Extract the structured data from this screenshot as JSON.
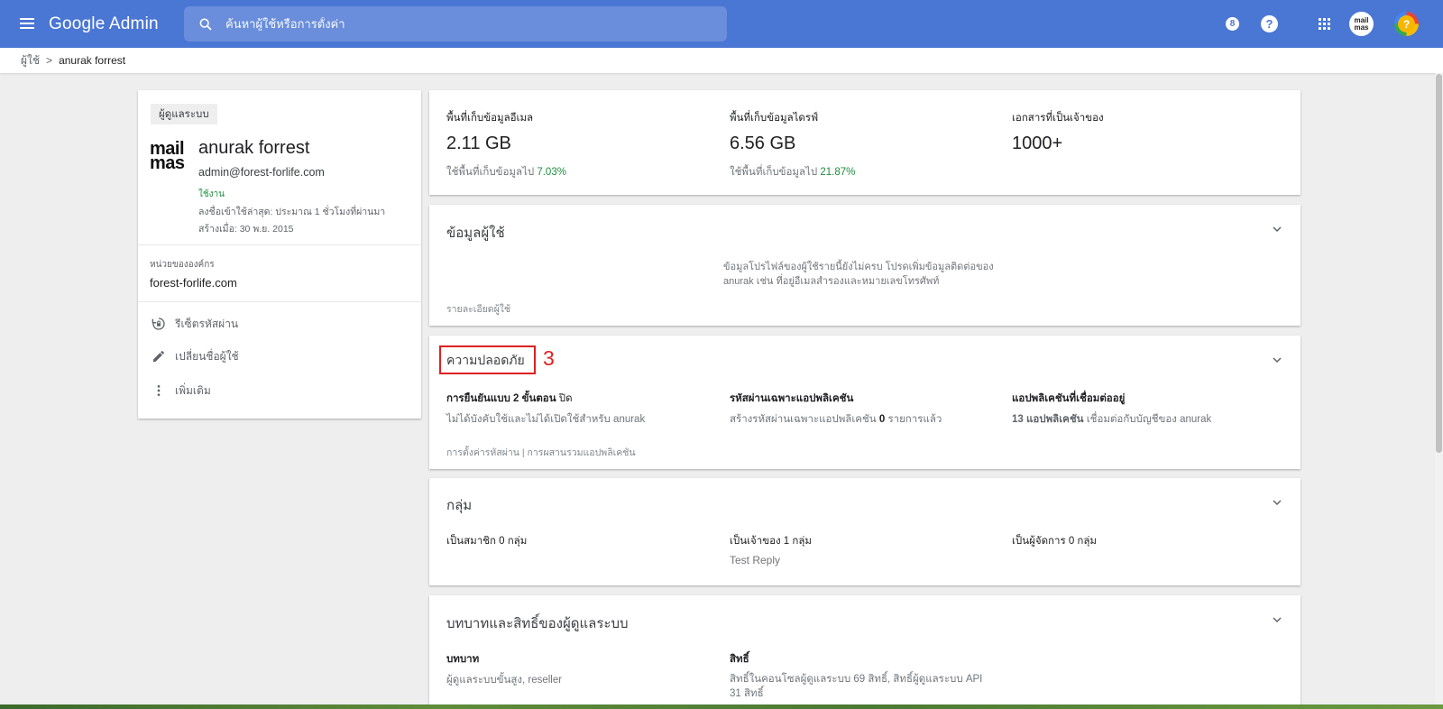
{
  "topbar": {
    "brand": "Google Admin",
    "search_placeholder": "ค้นหาผู้ใช้หรือการตั้งค่า",
    "notification_count": "8",
    "help_label": "?",
    "org_avatar_text": "mail\nmas",
    "user_avatar_text": "?"
  },
  "breadcrumb": {
    "root": "ผู้ใช้",
    "separator": ">",
    "current": "anurak forrest"
  },
  "profile": {
    "role": "ผู้ดูแลระบบ",
    "logo_text": "mail mas",
    "name": "anurak forrest",
    "email": "admin@forest-forlife.com",
    "status": "ใช้งาน",
    "last_login": "ลงชื่อเข้าใช้ล่าสุด: ประมาณ 1 ชั่วโมงที่ผ่านมา",
    "created": "สร้างเมื่อ: 30 พ.ย. 2015",
    "org_unit_label": "หน่วยขององค์กร",
    "org_unit_value": "forest-forlife.com",
    "actions": [
      {
        "label": "รีเซ็ตรหัสผ่าน",
        "icon": "lock-reset-icon"
      },
      {
        "label": "เปลี่ยนชื่อผู้ใช้",
        "icon": "pencil-icon"
      },
      {
        "label": "เพิ่มเติม",
        "icon": "more-vert-icon"
      }
    ]
  },
  "storage": {
    "email": {
      "label": "พื้นที่เก็บข้อมูลอีเมล",
      "value": "2.11 GB",
      "used_prefix": "ใช้พื้นที่เก็บข้อมูลไป",
      "used_pct": "7.03%"
    },
    "drive": {
      "label": "พื้นที่เก็บข้อมูลไดรฟ์",
      "value": "6.56 GB",
      "used_prefix": "ใช้พื้นที่เก็บข้อมูลไป",
      "used_pct": "21.87%"
    },
    "docs": {
      "label": "เอกสารที่เป็นเจ้าของ",
      "value": "1000+"
    }
  },
  "user_info": {
    "title": "ข้อมูลผู้ใช้",
    "message_line1": "ข้อมูลโปรไฟล์ของผู้ใช้รายนี้ยังไม่ครบ โปรดเพิ่มข้อมูลติดต่อของ",
    "message_line2": "anurak เช่น ที่อยู่อีเมลสำรองและหมายเลขโทรศัพท์",
    "footer_link": "รายละเอียดผู้ใช้"
  },
  "security": {
    "title": "ความปลอดภัย",
    "annotation": "3",
    "two_step": {
      "label_prefix": "การยืนยันแบบ 2 ขั้นตอน",
      "label_state": "ปิด",
      "detail": "ไม่ได้บังคับใช้และไม่ได้เปิดใช้สำหรับ anurak"
    },
    "app_passwords": {
      "label": "รหัสผ่านเฉพาะแอปพลิเคชัน",
      "detail_prefix": "สร้างรหัสผ่านเฉพาะแอปพลิเคชัน",
      "detail_count": "0",
      "detail_suffix": "รายการแล้ว"
    },
    "connected_apps": {
      "label": "แอปพลิเคชันที่เชื่อมต่ออยู่",
      "detail_bold": "13 แอปพลิเคชัน",
      "detail_suffix": "เชื่อมต่อกับบัญชีของ anurak"
    },
    "footer_link1": "การตั้งค่ารหัสผ่าน",
    "footer_sep": "|",
    "footer_link2": "การผสานรวมแอปพลิเคชัน"
  },
  "groups": {
    "title": "กลุ่ม",
    "member": "เป็นสมาชิก 0 กลุ่ม",
    "owner": "เป็นเจ้าของ 1 กลุ่ม",
    "owner_group": "Test Reply",
    "manager": "เป็นผู้จัดการ 0 กลุ่ม"
  },
  "roles": {
    "title": "บทบาทและสิทธิ์ของผู้ดูแลระบบ",
    "roles_label": "บทบาท",
    "roles_value": "ผู้ดูแลระบบขั้นสูง, reseller",
    "privileges_label": "สิทธิ์",
    "privileges_line1": "สิทธิ์ในคอนโซลผู้ดูแลระบบ 69 สิทธิ์, สิทธิ์ผู้ดูแลระบบ API",
    "privileges_line2": "31 สิทธิ์"
  },
  "colors": {
    "topbar": "#4a76d4",
    "accent_green": "#1e8e3e",
    "annotation_red": "#e02020"
  }
}
